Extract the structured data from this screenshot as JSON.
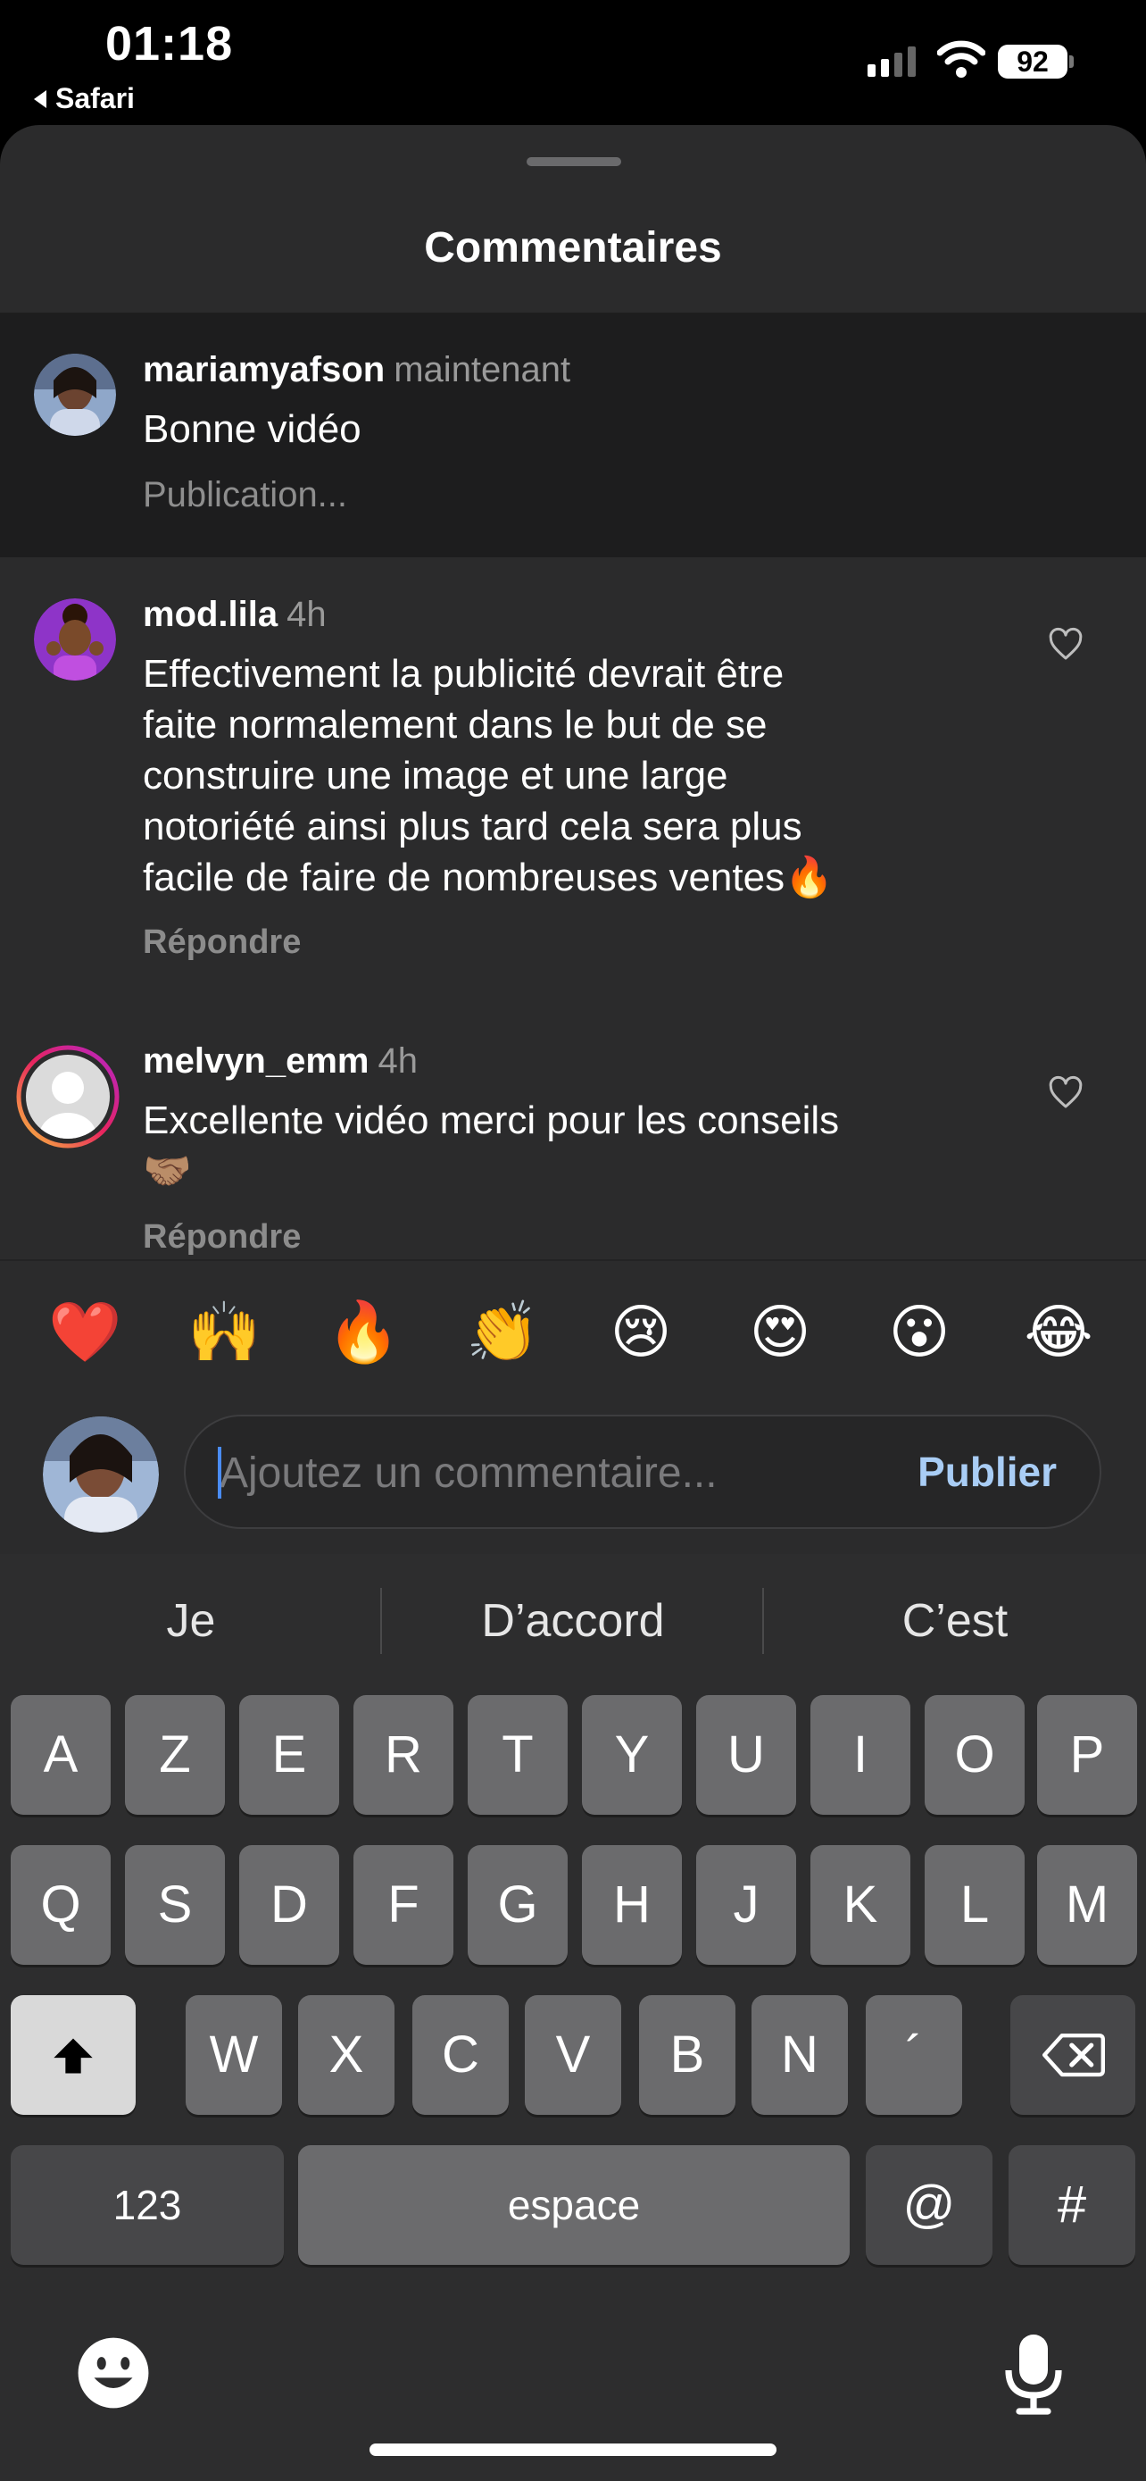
{
  "status_bar": {
    "time": "01:18",
    "back_label": "Safari",
    "battery": "92"
  },
  "sheet": {
    "title": "Commentaires"
  },
  "pending_comment": {
    "username": "mariamyafson",
    "time": "maintenant",
    "text": "Bonne vidéo",
    "status": "Publication..."
  },
  "comments": [
    {
      "username": "mod.lila",
      "time": "4h",
      "lines": [
        "Effectivement la publicité devrait être",
        "faite normalement dans le but de se",
        "construire une image et une large",
        "notoriété ainsi plus tard cela sera plus",
        "facile de faire de nombreuses ventes🔥"
      ],
      "reply": "Répondre"
    },
    {
      "username": "melvyn_emm",
      "time": "4h",
      "lines": [
        "Excellente vidéo merci pour les conseils",
        "🤝🏽"
      ],
      "reply": "Répondre"
    }
  ],
  "emoji_reactions": [
    "❤️",
    "🙌",
    "🔥",
    "👏",
    "😢",
    "😍",
    "😮",
    "😂"
  ],
  "composer": {
    "placeholder": "Ajoutez un commentaire...",
    "publish_label": "Publier"
  },
  "keyboard": {
    "suggestions": [
      "Je",
      "D’accord",
      "C’est"
    ],
    "row1": [
      "A",
      "Z",
      "E",
      "R",
      "T",
      "Y",
      "U",
      "I",
      "O",
      "P"
    ],
    "row2": [
      "Q",
      "S",
      "D",
      "F",
      "G",
      "H",
      "J",
      "K",
      "L",
      "M"
    ],
    "row3": [
      "W",
      "X",
      "C",
      "V",
      "B",
      "N",
      "´"
    ],
    "numbers_label": "123",
    "space_label": "espace",
    "at_label": "@",
    "hash_label": "#"
  },
  "icons": {
    "like": "heart-outline-icon",
    "shift": "shift-arrow-icon",
    "delete": "delete-backspace-icon",
    "emoji": "emoji-face-icon",
    "mic": "microphone-icon"
  }
}
